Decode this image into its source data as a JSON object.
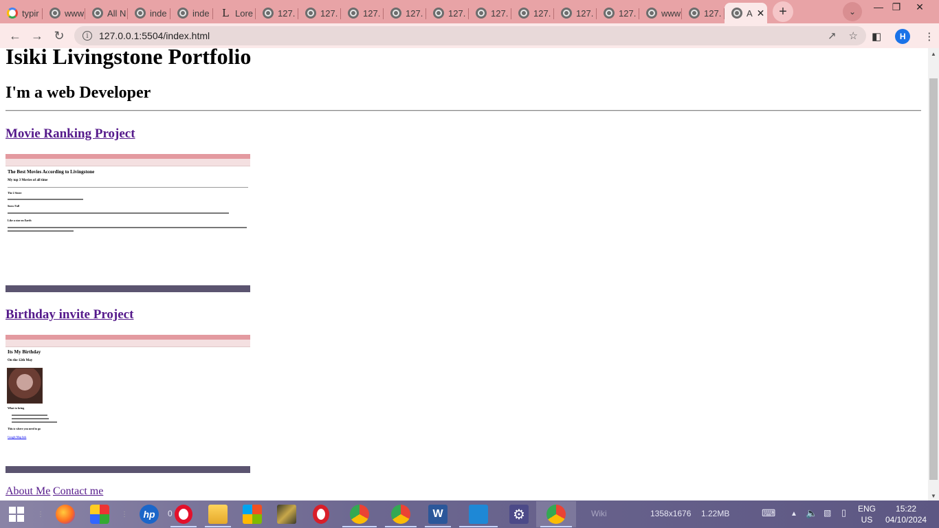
{
  "browser": {
    "tabs": [
      {
        "label": "typir",
        "icon": "google-icon"
      },
      {
        "label": "www",
        "icon": "globe-icon"
      },
      {
        "label": "All N",
        "icon": "globe-icon"
      },
      {
        "label": "inde",
        "icon": "globe-icon"
      },
      {
        "label": "inde",
        "icon": "globe-icon"
      },
      {
        "label": "Lore",
        "icon": "lorem-icon"
      },
      {
        "label": "127.",
        "icon": "globe-icon"
      },
      {
        "label": "127.",
        "icon": "globe-icon"
      },
      {
        "label": "127.",
        "icon": "globe-icon"
      },
      {
        "label": "127.",
        "icon": "globe-icon"
      },
      {
        "label": "127.",
        "icon": "globe-icon"
      },
      {
        "label": "127.",
        "icon": "globe-icon"
      },
      {
        "label": "127.",
        "icon": "globe-icon"
      },
      {
        "label": "127.",
        "icon": "globe-icon"
      },
      {
        "label": "127.",
        "icon": "globe-icon"
      },
      {
        "label": "www",
        "icon": "globe-icon"
      },
      {
        "label": "127.",
        "icon": "globe-icon"
      },
      {
        "label": "A",
        "icon": "globe-icon",
        "active": true
      }
    ],
    "address": "127.0.0.1:5504/index.html",
    "profile_initial": "H"
  },
  "page": {
    "title": "Isiki Livingstone Portfolio",
    "subtitle": "I'm a web Developer",
    "projects": [
      {
        "link": "Movie Ranking Project",
        "thumb": {
          "heading": "The Best Movies According to Livingstone",
          "subheading": "My top 3 Movies of all time",
          "items": [
            "The 2 Sister",
            "Snow Fall",
            "Like a star on Earth"
          ]
        }
      },
      {
        "link": "Birthday invite Project",
        "thumb": {
          "heading": "Its My Birthday",
          "subheading": "On the 12th May",
          "bring": "What to bring",
          "where": "This is where you need to go",
          "map_link": "Google Map link"
        }
      }
    ],
    "footer_links": [
      "About Me",
      "Contact me"
    ]
  },
  "taskbar": {
    "status_left": "0",
    "watermark": "Wiki",
    "resolution": "1358x1676",
    "size": "1.22MB",
    "lang_top": "ENG",
    "lang_bottom": "US",
    "time": "15:22",
    "date": "04/10/2024"
  }
}
